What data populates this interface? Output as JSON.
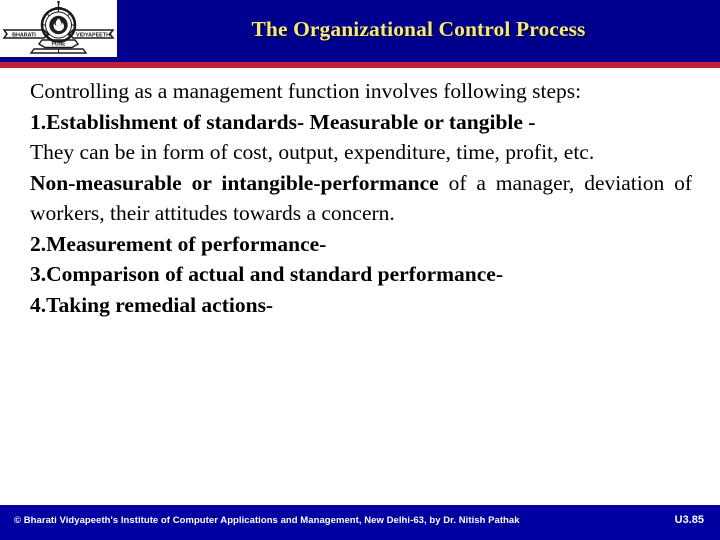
{
  "slide": {
    "header": {
      "title": "The Organizational Control Process",
      "logo": {
        "icon_name": "bharati-vidyapeeth-logo",
        "left_banner_text": "BHARATI",
        "right_banner_text": "VIDYAPEETH",
        "scroll_text": "PUNE"
      },
      "bar_color": "#00008f",
      "rule_color": "#c0213a",
      "title_color": "#f5e97b"
    },
    "body": {
      "lines": [
        {
          "id": "intro",
          "segments": [
            {
              "text": "Controlling as a management function involves following steps:",
              "bold": false
            }
          ],
          "align": "justify"
        },
        {
          "id": "step-1",
          "segments": [
            {
              "text": "1.Establishment of standards- Measurable or tangible -",
              "bold": true
            }
          ],
          "align": "justify"
        },
        {
          "id": "step-1-detail",
          "segments": [
            {
              "text": "They can be in form of cost, output, expenditure, time, profit, etc.",
              "bold": false
            }
          ],
          "align": "justify"
        },
        {
          "id": "non-measurable",
          "segments": [
            {
              "text": "Non-measurable or intangible-performance ",
              "bold": true
            },
            {
              "text": "of a manager, deviation of workers, their attitudes towards a concern.",
              "bold": false
            }
          ],
          "align": "justify"
        },
        {
          "id": "step-2",
          "segments": [
            {
              "text": "2.Measurement of performance-",
              "bold": true
            }
          ],
          "align": "left"
        },
        {
          "id": "step-3",
          "segments": [
            {
              "text": "3.Comparison of actual and standard performance-",
              "bold": true
            }
          ],
          "align": "left"
        },
        {
          "id": "step-4",
          "segments": [
            {
              "text": "4.Taking remedial actions-",
              "bold": true
            }
          ],
          "align": "left"
        }
      ]
    },
    "footer": {
      "credit": "© Bharati Vidyapeeth's Institute of Computer Applications and Management, New Delhi-63, by Dr. Nitish Pathak",
      "page_label": "U3.85",
      "bar_color": "#0000a0",
      "text_color": "#ffffff"
    }
  }
}
